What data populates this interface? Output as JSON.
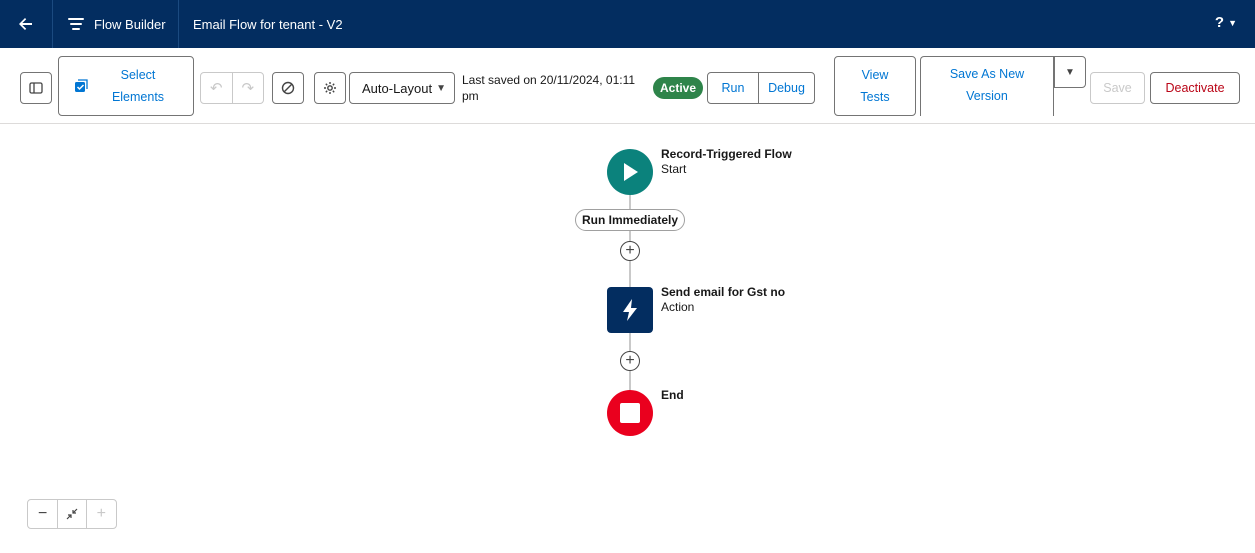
{
  "topbar": {
    "app_name": "Flow Builder",
    "flow_title": "Email Flow for tenant - V2",
    "help_label": "?"
  },
  "toolbar": {
    "select_elements_line1": "Select",
    "select_elements_line2": "Elements",
    "autolayout_label": "Auto-Layout",
    "saved_text": "Last saved on 20/11/2024, 01:11 pm",
    "status_badge": "Active",
    "run_label": "Run",
    "debug_label": "Debug",
    "view_tests_line1": "View",
    "view_tests_line2": "Tests",
    "save_as_new_line1": "Save As New",
    "save_as_new_line2": "Version",
    "save_label": "Save",
    "deactivate_label": "Deactivate"
  },
  "canvas": {
    "start": {
      "title": "Record-Triggered Flow",
      "subtitle": "Start"
    },
    "path_label": "Run Immediately",
    "action": {
      "title": "Send email for Gst no",
      "subtitle": "Action"
    },
    "end": {
      "title": "End"
    }
  },
  "colors": {
    "nav_bg": "#032d60",
    "brand_blue": "#0176d3",
    "start_teal": "#0b827c",
    "action_navy": "#032d60",
    "end_red": "#ea001e",
    "active_green": "#2e844a",
    "deactivate_red": "#ba0517"
  },
  "icons": [
    "back-arrow-icon",
    "flow-builder-icon",
    "help-icon",
    "toggle-panel-icon",
    "select-elements-icon",
    "undo-icon",
    "redo-icon",
    "disable-icon",
    "settings-icon",
    "dropdown-caret-icon",
    "play-icon",
    "lightning-icon",
    "stop-icon",
    "add-icon",
    "zoom-out-icon",
    "fit-view-icon",
    "zoom-in-icon"
  ]
}
